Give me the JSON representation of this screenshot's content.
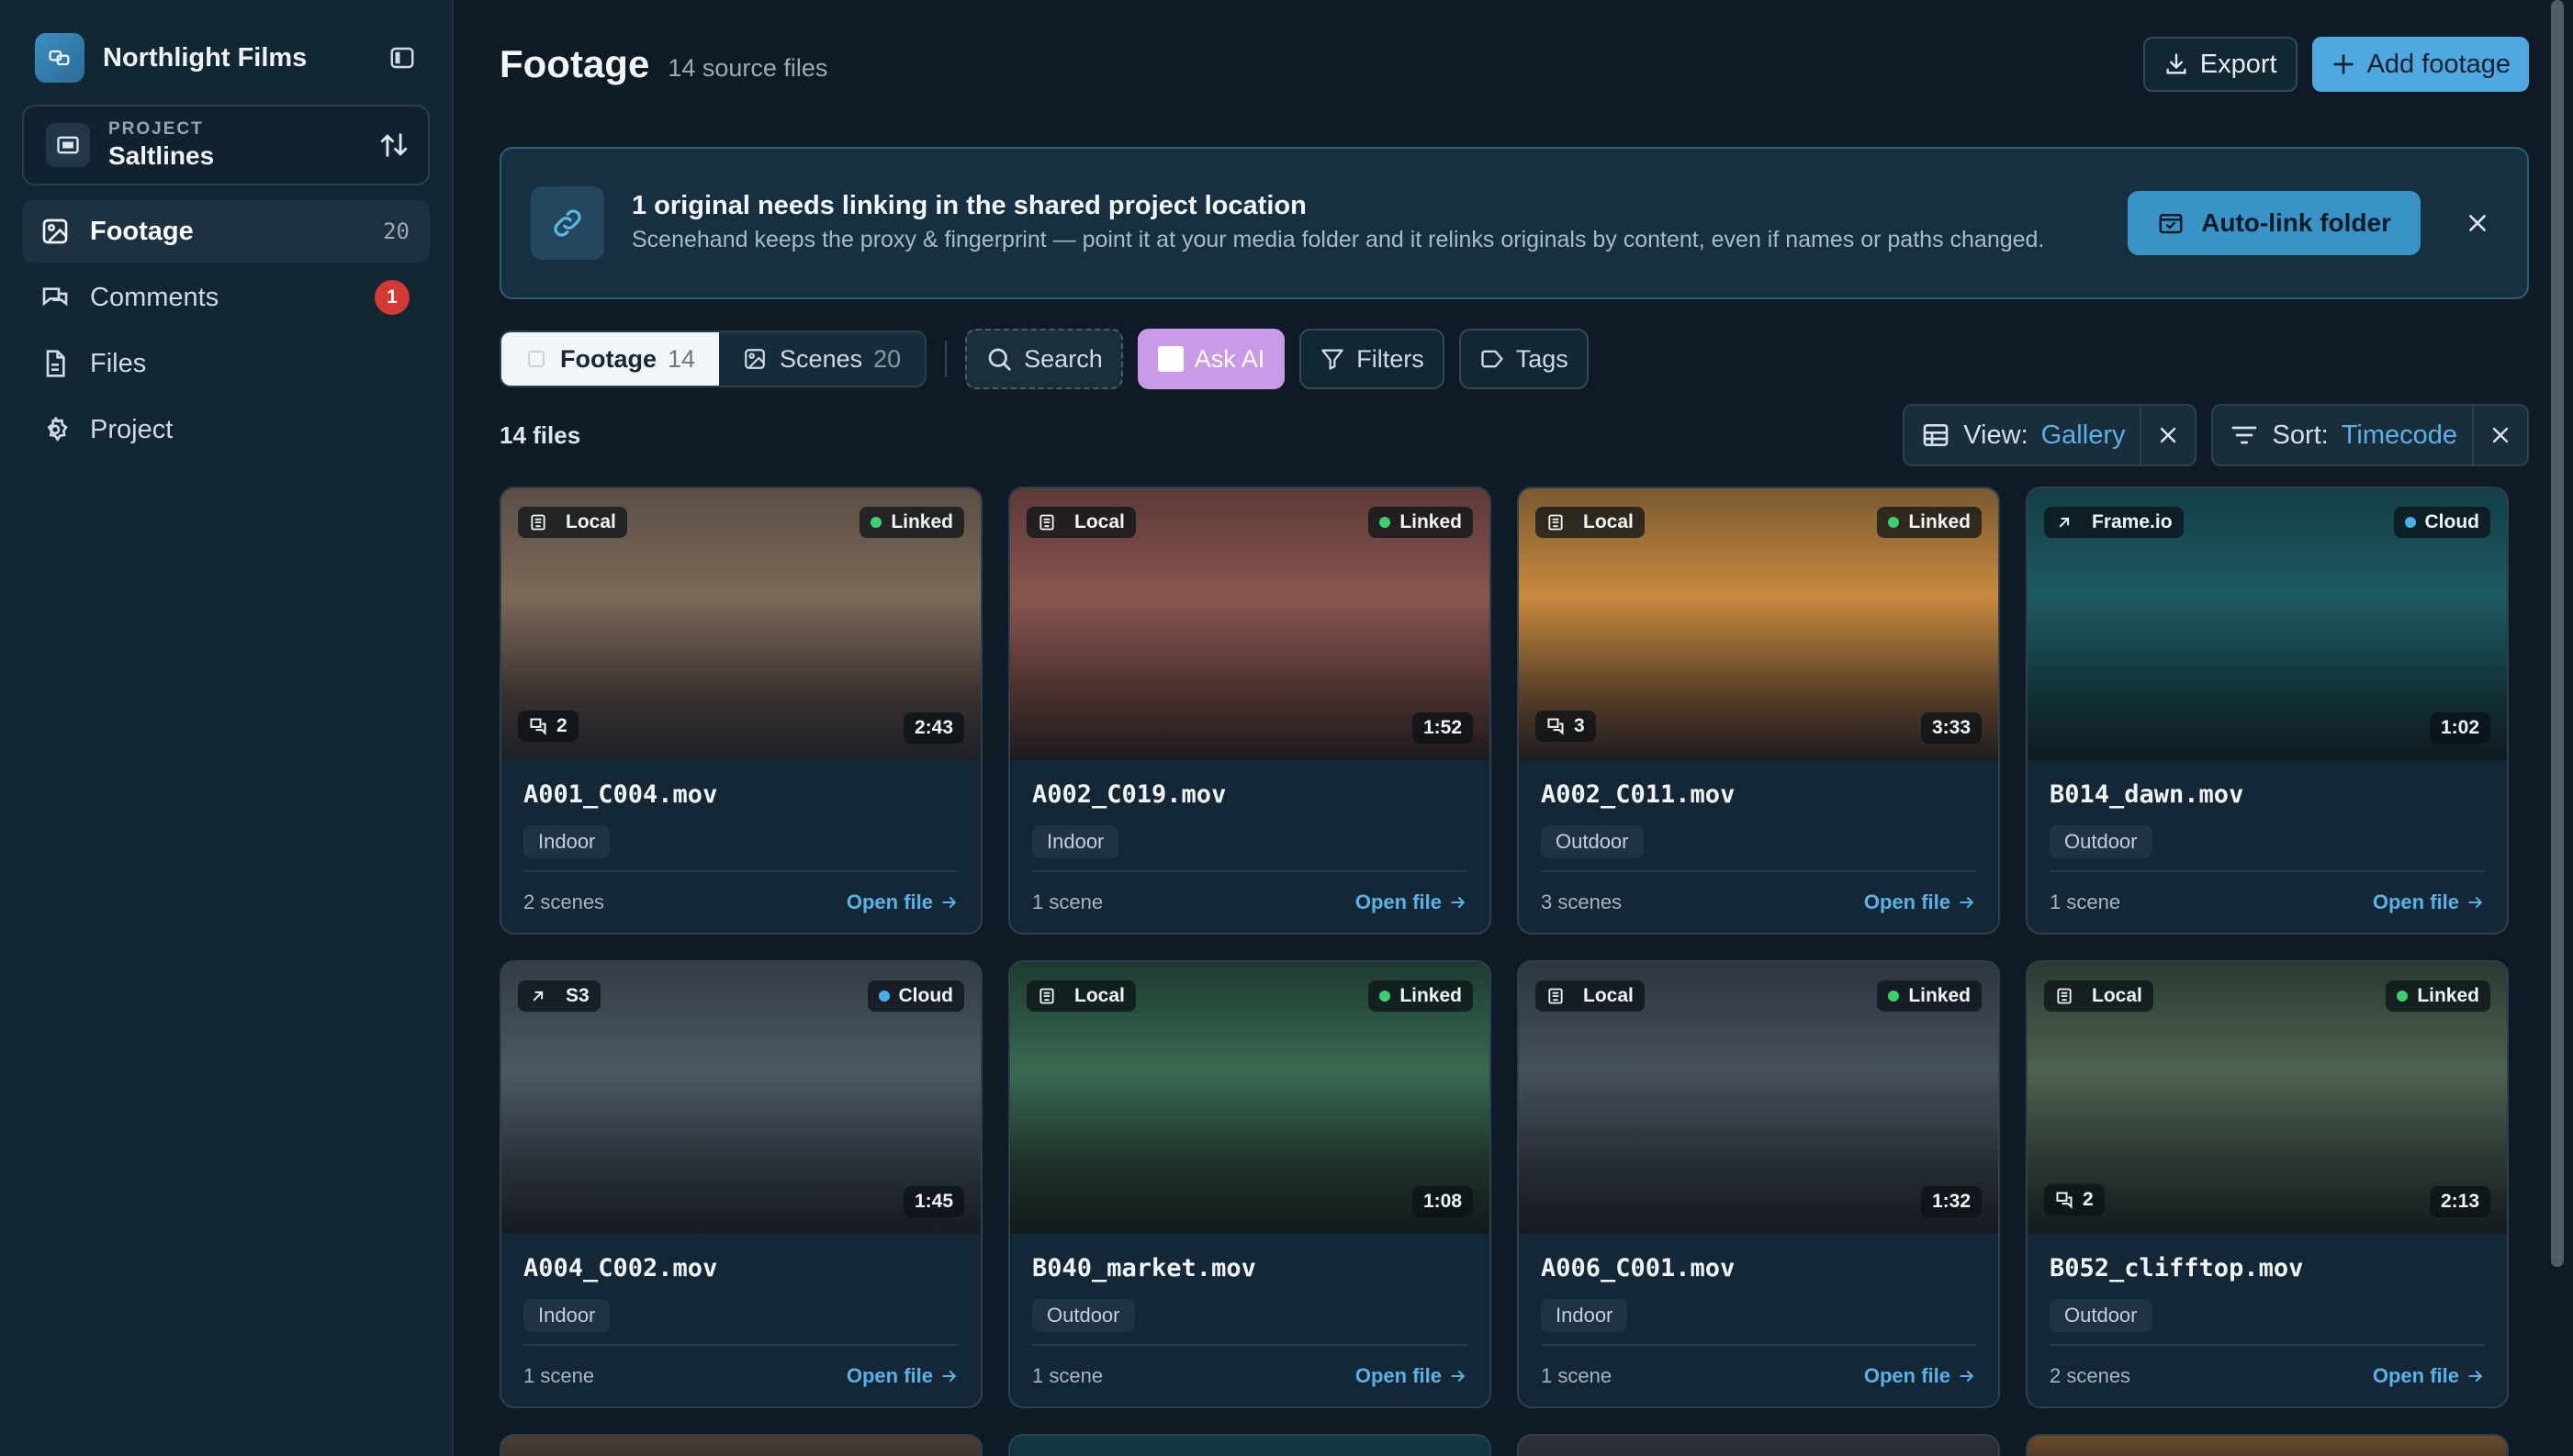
{
  "sidebar": {
    "org_name": "Northlight Films",
    "project_label": "PROJECT",
    "project_name": "Saltlines",
    "items": [
      {
        "label": "Footage",
        "count": "20"
      },
      {
        "label": "Comments",
        "badge": "1"
      },
      {
        "label": "Files"
      },
      {
        "label": "Project"
      }
    ]
  },
  "header": {
    "title": "Footage",
    "subtitle": "14 source files",
    "export_label": "Export",
    "add_label": "Add footage"
  },
  "banner": {
    "title": "1 original needs linking in the shared project location",
    "body": "Scenehand keeps the proxy & fingerprint — point it at your media folder and it relinks originals by content, even if names or paths changed.",
    "action_label": "Auto-link folder"
  },
  "toolbar": {
    "tabs": [
      {
        "label": "Footage",
        "count": "14"
      },
      {
        "label": "Scenes",
        "count": "20"
      }
    ],
    "search_label": "Search",
    "ask_ai_label": "Ask AI",
    "filters_label": "Filters",
    "tags_label": "Tags"
  },
  "list": {
    "count_label": "14 files",
    "view_key": "View:",
    "view_value": "Gallery",
    "sort_key": "Sort:",
    "sort_value": "Timecode"
  },
  "colors": {
    "accent": "#4fa8de",
    "linked": "#3ccf6e",
    "cloud": "#45b0ec",
    "ai": "#c99ae6",
    "badge": "#d43a35"
  },
  "cards": [
    {
      "source": "Local",
      "source_icon": "drive-icon",
      "status": "Linked",
      "status_color": "#3ccf6e",
      "comments": "2",
      "duration": "2:43",
      "filename": "A001_C004.mov",
      "tag": "Indoor",
      "scenes": "2 scenes",
      "open_label": "Open file",
      "thumb": "linear-gradient(180deg,#5a4e44 0%,#7c6a58 40%,#3a3230 75%,#1c2026 100%)"
    },
    {
      "source": "Local",
      "source_icon": "drive-icon",
      "status": "Linked",
      "status_color": "#3ccf6e",
      "comments": "",
      "duration": "1:52",
      "filename": "A002_C019.mov",
      "tag": "Indoor",
      "scenes": "1 scene",
      "open_label": "Open file",
      "thumb": "linear-gradient(180deg,#5c3a36 0%,#8a5550 40%,#4a302e 75%,#1e1a1e 100%)"
    },
    {
      "source": "Local",
      "source_icon": "drive-icon",
      "status": "Linked",
      "status_color": "#3ccf6e",
      "comments": "3",
      "duration": "3:33",
      "filename": "A002_C011.mov",
      "tag": "Outdoor",
      "scenes": "3 scenes",
      "open_label": "Open file",
      "thumb": "linear-gradient(180deg,#7a5a30 0%,#c88a3e 40%,#5a4028 75%,#1e1c1e 100%)"
    },
    {
      "source": "Frame.io",
      "source_icon": "arrow-up-right-icon",
      "status": "Cloud",
      "status_color": "#45b0ec",
      "comments": "",
      "duration": "1:02",
      "filename": "B014_dawn.mov",
      "tag": "Outdoor",
      "scenes": "1 scene",
      "open_label": "Open file",
      "thumb": "linear-gradient(180deg,#143e48 0%,#1e5a62 40%,#123238 75%,#0e1a20 100%)"
    },
    {
      "source": "S3",
      "source_icon": "arrow-up-right-icon",
      "status": "Cloud",
      "status_color": "#45b0ec",
      "comments": "",
      "duration": "1:45",
      "filename": "A004_C002.mov",
      "tag": "Indoor",
      "scenes": "1 scene",
      "open_label": "Open file",
      "thumb": "linear-gradient(180deg,#343c46 0%,#4c5864 40%,#2a3038 75%,#171c22 100%)"
    },
    {
      "source": "Local",
      "source_icon": "drive-icon",
      "status": "Linked",
      "status_color": "#3ccf6e",
      "comments": "",
      "duration": "1:08",
      "filename": "B040_market.mov",
      "tag": "Outdoor",
      "scenes": "1 scene",
      "open_label": "Open file",
      "thumb": "linear-gradient(180deg,#1e3a30 0%,#3a6a52 40%,#1e3028 75%,#121a1c 100%)"
    },
    {
      "source": "Local",
      "source_icon": "drive-icon",
      "status": "Linked",
      "status_color": "#3ccf6e",
      "comments": "",
      "duration": "1:32",
      "filename": "A006_C001.mov",
      "tag": "Indoor",
      "scenes": "1 scene",
      "open_label": "Open file",
      "thumb": "linear-gradient(180deg,#2e3640 0%,#46505a 40%,#262c34 75%,#161a20 100%)"
    },
    {
      "source": "Local",
      "source_icon": "drive-icon",
      "status": "Linked",
      "status_color": "#3ccf6e",
      "comments": "2",
      "duration": "2:13",
      "filename": "B052_clifftop.mov",
      "tag": "Outdoor",
      "scenes": "2 scenes",
      "open_label": "Open file",
      "thumb": "linear-gradient(180deg,#2a3a32 0%,#4e6250 40%,#2a3430 75%,#161c1e 100%)"
    }
  ],
  "peek_thumbs": [
    "#4a3e34",
    "#123a44",
    "#2e3036",
    "#6a4a2a"
  ]
}
